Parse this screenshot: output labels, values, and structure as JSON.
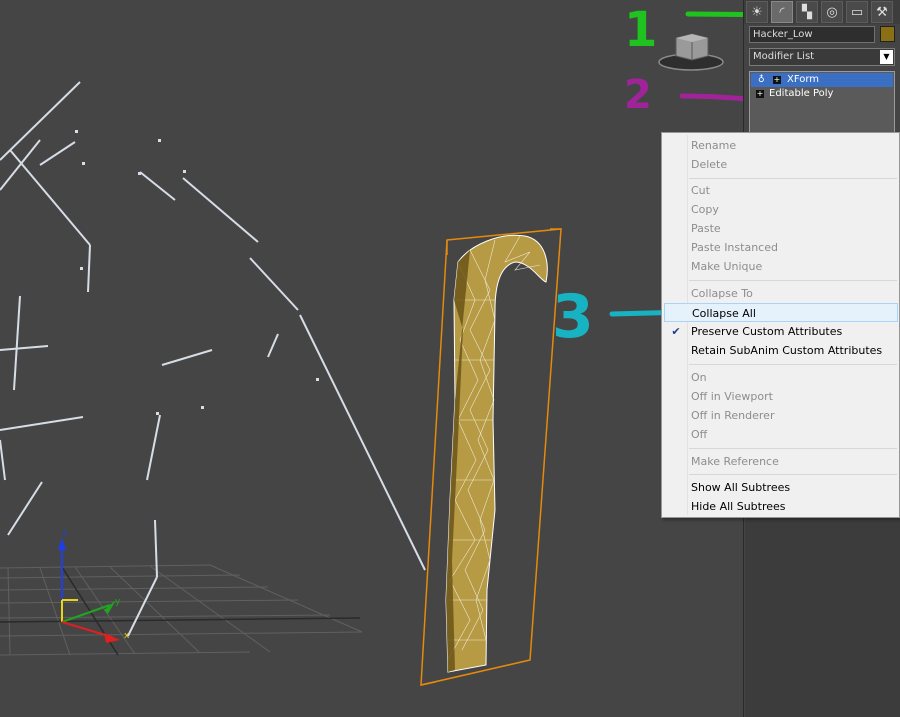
{
  "command_panel": {
    "tabs": [
      {
        "name": "create",
        "icon": "sun-icon"
      },
      {
        "name": "modify",
        "icon": "modify-arc-icon"
      },
      {
        "name": "hierarchy",
        "icon": "hierarchy-icon"
      },
      {
        "name": "motion",
        "icon": "motion-icon"
      },
      {
        "name": "display",
        "icon": "display-icon"
      },
      {
        "name": "utilities",
        "icon": "hammer-icon"
      }
    ],
    "object_name": "Hacker_Low",
    "object_color": "#8b6f14",
    "modifier_list_label": "Modifier List",
    "stack": [
      {
        "label": "XForm",
        "selected": true
      },
      {
        "label": "Editable Poly",
        "selected": false
      }
    ]
  },
  "context_menu": {
    "items": [
      {
        "label": "Rename",
        "disabled": true
      },
      {
        "label": "Delete",
        "disabled": true
      },
      {
        "label": "Cut",
        "disabled": true
      },
      {
        "label": "Copy",
        "disabled": true
      },
      {
        "label": "Paste",
        "disabled": true
      },
      {
        "label": "Paste Instanced",
        "disabled": true
      },
      {
        "label": "Make Unique",
        "disabled": true
      },
      {
        "label": "Collapse To",
        "disabled": true
      },
      {
        "label": "Collapse All",
        "disabled": false,
        "hovered": true
      },
      {
        "label": "Preserve Custom Attributes",
        "disabled": false,
        "checked": true
      },
      {
        "label": "Retain SubAnim Custom Attributes",
        "disabled": false
      },
      {
        "label": "On",
        "disabled": true
      },
      {
        "label": "Off in Viewport",
        "disabled": true
      },
      {
        "label": "Off in Renderer",
        "disabled": true
      },
      {
        "label": "Off",
        "disabled": true
      },
      {
        "label": "Make Reference",
        "disabled": true
      },
      {
        "label": "Show All Subtrees",
        "disabled": false
      },
      {
        "label": "Hide All Subtrees",
        "disabled": false
      }
    ]
  },
  "viewport": {
    "gizmo_labels": {
      "z": "z",
      "y": "y",
      "x": "x"
    },
    "viewcube_icon": "viewcube-icon"
  },
  "annotations": [
    {
      "text": "1",
      "color": "#1fc21f"
    },
    {
      "text": "2",
      "color": "#a0239a"
    },
    {
      "text": "3",
      "color": "#18b3c2"
    }
  ]
}
